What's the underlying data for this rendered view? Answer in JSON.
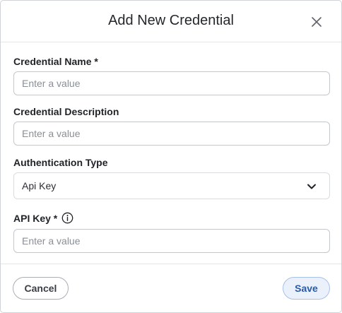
{
  "dialog": {
    "title": "Add New Credential",
    "close_icon": "close-icon"
  },
  "fields": {
    "credential_name": {
      "label": "Credential Name *",
      "placeholder": "Enter a value",
      "value": ""
    },
    "credential_description": {
      "label": "Credential Description",
      "placeholder": "Enter a value",
      "value": ""
    },
    "authentication_type": {
      "label": "Authentication Type",
      "selected": "Api Key",
      "icon": "chevron-down-icon"
    },
    "api_key": {
      "label": "API Key *",
      "placeholder": "Enter a value",
      "value": "",
      "icon": "info-icon"
    }
  },
  "footer": {
    "cancel_label": "Cancel",
    "save_label": "Save"
  },
  "colors": {
    "primary_text": "#1f2226",
    "placeholder": "#8a8f96",
    "save_bg": "#eaf1fb",
    "save_text": "#2b5aa6",
    "border": "#c4c8cc"
  }
}
